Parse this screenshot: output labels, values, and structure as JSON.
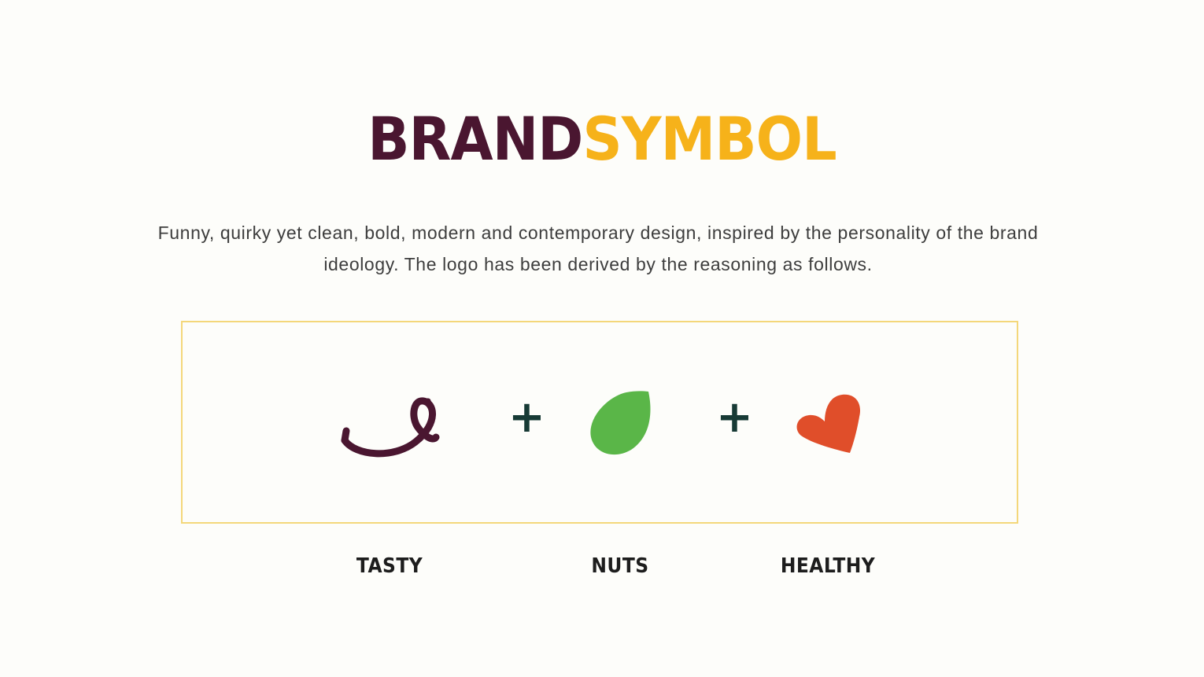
{
  "title": {
    "part_a": "BRAND",
    "part_b": "SYMBOL"
  },
  "description": "Funny, quirky yet clean, bold, modern and contemporary design, inspired by the personality of the brand ideology. The logo has been derived by the reasoning as follows.",
  "symbols": [
    {
      "label": "TASTY",
      "icon": "smile-swirl-icon",
      "color": "#4a1630"
    },
    {
      "label": "NUTS",
      "icon": "leaf-icon",
      "color": "#5ab648"
    },
    {
      "label": "HEALTHY",
      "icon": "heart-icon",
      "color": "#e04e2a"
    }
  ],
  "operator": "+",
  "colors": {
    "brand_dark": "#4a1630",
    "brand_yellow": "#f6b21a",
    "panel_border": "#f4d77a",
    "plus": "#173a35"
  }
}
